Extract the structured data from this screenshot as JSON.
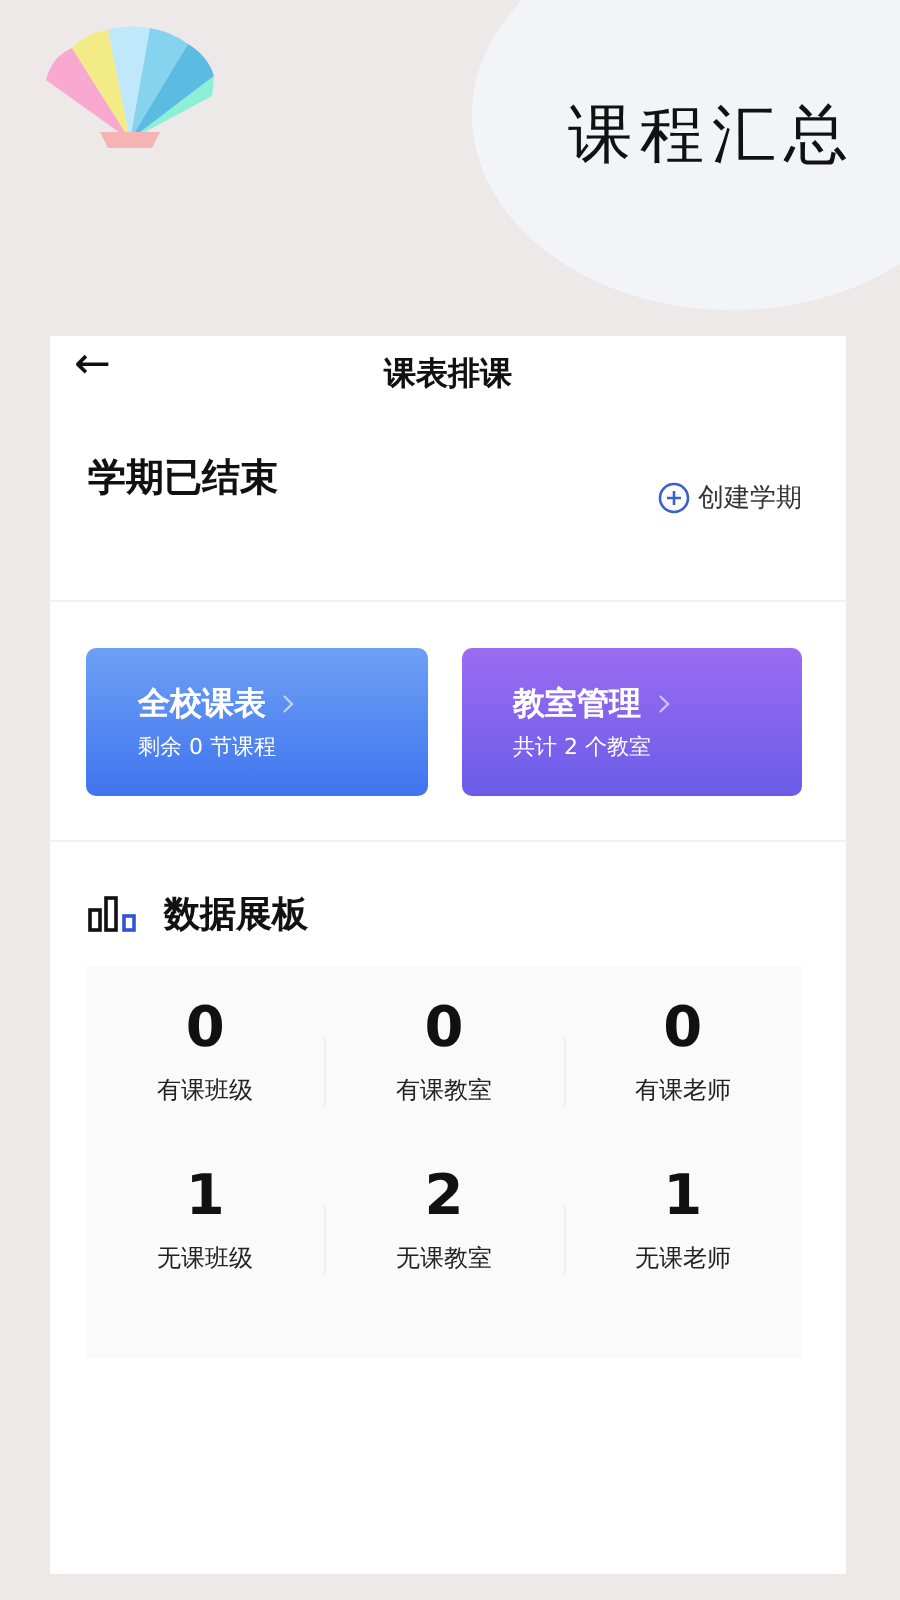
{
  "banner": {
    "title": "课程汇总"
  },
  "nav": {
    "back": "←",
    "title": "课表排课"
  },
  "term": {
    "status": "学期已结束",
    "action": "创建学期"
  },
  "shortcuts": [
    {
      "kind": "blue",
      "title": "全校课表",
      "subtitle": "剩余 0 节课程"
    },
    {
      "kind": "purple",
      "title": "教室管理",
      "subtitle": "共计 2 个教室"
    }
  ],
  "dashboard": {
    "title": "数据展板",
    "stats": [
      {
        "value": "0",
        "label": "有课班级"
      },
      {
        "value": "0",
        "label": "有课教室"
      },
      {
        "value": "0",
        "label": "有课老师"
      },
      {
        "value": "1",
        "label": "无课班级"
      },
      {
        "value": "2",
        "label": "无课教室"
      },
      {
        "value": "1",
        "label": "无课老师"
      }
    ]
  }
}
